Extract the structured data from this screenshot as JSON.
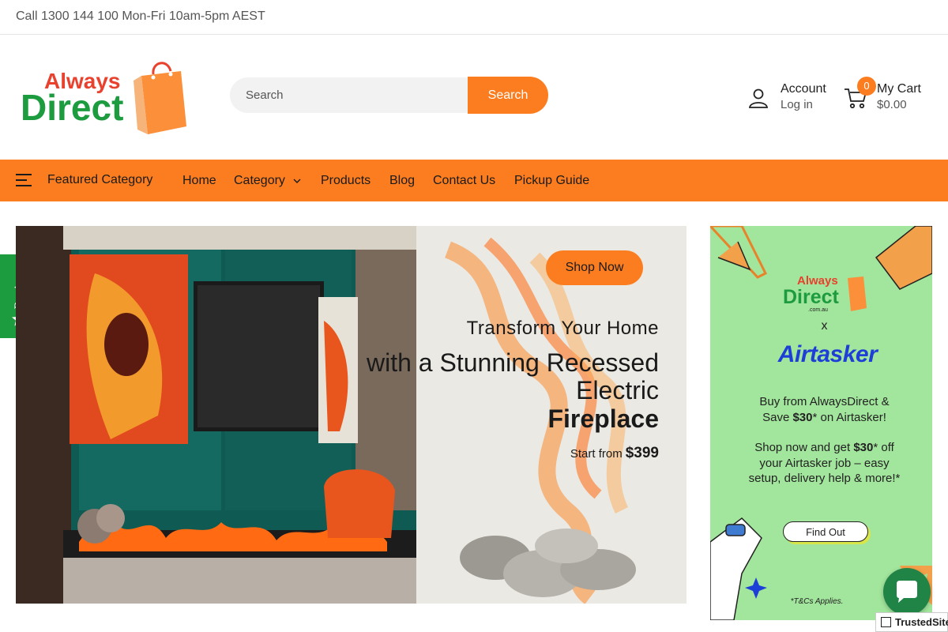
{
  "topbar": {
    "text": "Call 1300 144 100 Mon-Fri 10am-5pm AEST"
  },
  "header": {
    "logo_alt": "Always Direct",
    "logo_word1": "Always",
    "logo_word2": "Direct",
    "search": {
      "placeholder": "Search",
      "button_label": "Search"
    },
    "account": {
      "label": "Account",
      "sublabel": "Log in"
    },
    "cart": {
      "label": "My Cart",
      "total": "$0.00",
      "count": "0"
    }
  },
  "nav": {
    "featured_label": "Featured Category",
    "links": [
      "Home",
      "Category",
      "Products",
      "Blog",
      "Contact Us",
      "Pickup Guide"
    ]
  },
  "reviews_tab": {
    "label": "Reviews"
  },
  "hero": {
    "title1": "Transform Your Home",
    "title2": "with a Stunning Recessed Electric",
    "title3": "Fireplace",
    "from_label": "Start from",
    "price": "$399",
    "cta": "Shop Now"
  },
  "promo": {
    "logo_word1": "Always",
    "logo_word2": "Direct",
    "logo_sub": ".com.au",
    "x": "x",
    "brand": "Airtasker",
    "line1": "Buy from AlwaysDirect &",
    "line2_prefix": "Save ",
    "line2_price": "$30",
    "line2_suffix": "* on Airtasker!",
    "line3_prefix": "Shop now and get ",
    "line3_price": "$30",
    "line3_suffix": "* off",
    "line4": "your Airtasker job – easy",
    "line5": "setup, delivery help & more!*",
    "button": "Find Out",
    "terms": "*T&Cs Applies."
  },
  "trusted_badge": {
    "label": "TrustedSite"
  },
  "colors": {
    "accent": "#fb7d1f",
    "brand_green": "#1d9b3f",
    "promo_bg": "#a2e59c",
    "airtasker_blue": "#1d3fd8"
  }
}
